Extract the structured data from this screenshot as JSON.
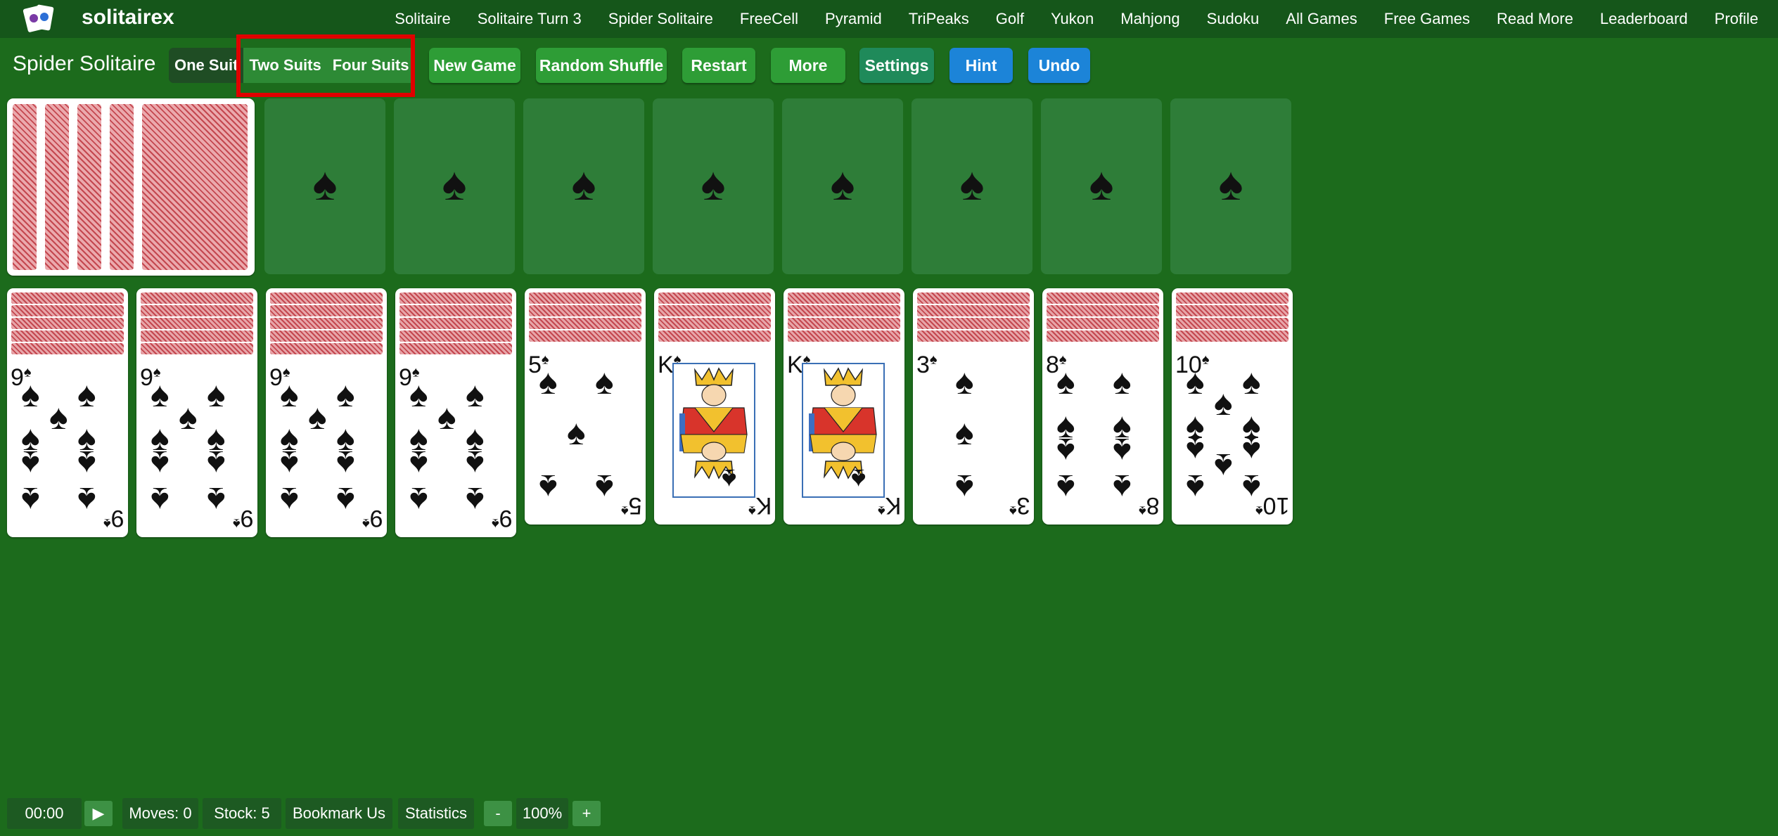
{
  "brand": "solitairex",
  "nav": [
    "Solitaire",
    "Solitaire Turn 3",
    "Spider Solitaire",
    "FreeCell",
    "Pyramid",
    "TriPeaks",
    "Golf",
    "Yukon",
    "Mahjong",
    "Sudoku",
    "All Games",
    "Free Games",
    "Read More",
    "Leaderboard",
    "Profile"
  ],
  "toolbar": {
    "title": "Spider Solitaire",
    "suits": [
      "One Suit",
      "Two Suits",
      "Four Suits"
    ],
    "new_game": "New Game",
    "random_shuffle": "Random Shuffle",
    "restart": "Restart",
    "more": "More",
    "settings": "Settings",
    "hint": "Hint",
    "undo": "Undo"
  },
  "foundation_suit": "♠",
  "tableau": [
    {
      "rank": "9",
      "hidden": 5
    },
    {
      "rank": "9",
      "hidden": 5
    },
    {
      "rank": "9",
      "hidden": 5
    },
    {
      "rank": "9",
      "hidden": 5
    },
    {
      "rank": "5",
      "hidden": 4
    },
    {
      "rank": "K",
      "hidden": 4
    },
    {
      "rank": "K",
      "hidden": 4
    },
    {
      "rank": "3",
      "hidden": 4
    },
    {
      "rank": "8",
      "hidden": 4
    },
    {
      "rank": "10",
      "hidden": 4
    }
  ],
  "status": {
    "time": "00:00",
    "play": "▶",
    "moves": "Moves: 0",
    "stock": "Stock: 5",
    "bookmark": "Bookmark Us",
    "statistics": "Statistics",
    "zoom_minus": "-",
    "zoom": "100%",
    "zoom_plus": "+"
  }
}
